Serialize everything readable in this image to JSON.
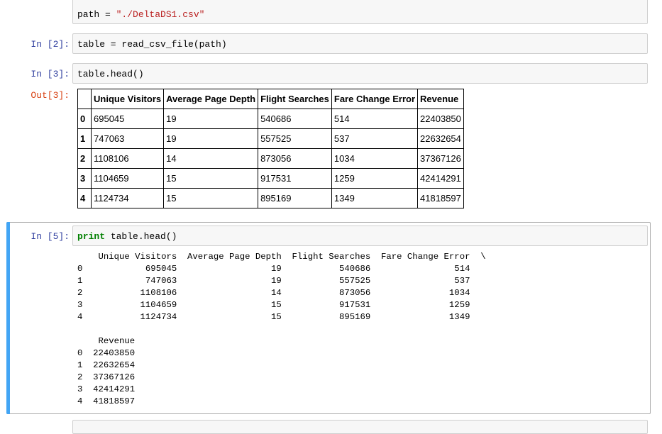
{
  "cells": [
    {
      "prompt": "",
      "code_prefix": "path = ",
      "code_string": "\"./DeltaDS1.csv\""
    },
    {
      "prompt": "In [2]:",
      "code": "table = read_csv_file(path)"
    },
    {
      "prompt": "In [3]:",
      "code": "table.head()"
    },
    {
      "out_prompt": "Out[3]:"
    },
    {
      "prompt": "In [5]:",
      "code_keyword": "print",
      "code_rest": " table.head()"
    }
  ],
  "dataframe": {
    "columns": [
      "Unique Visitors",
      "Average Page Depth",
      "Flight Searches",
      "Fare Change Error",
      "Revenue"
    ],
    "rows": [
      {
        "index": "0",
        "values": [
          "695045",
          "19",
          "540686",
          "514",
          "22403850"
        ]
      },
      {
        "index": "1",
        "values": [
          "747063",
          "19",
          "557525",
          "537",
          "22632654"
        ]
      },
      {
        "index": "2",
        "values": [
          "1108106",
          "14",
          "873056",
          "1034",
          "37367126"
        ]
      },
      {
        "index": "3",
        "values": [
          "1104659",
          "15",
          "917531",
          "1259",
          "42414291"
        ]
      },
      {
        "index": "4",
        "values": [
          "1124734",
          "15",
          "895169",
          "1349",
          "41818597"
        ]
      }
    ]
  },
  "print_output": {
    "block1": "    Unique Visitors  Average Page Depth  Flight Searches  Fare Change Error  \\\n0            695045                  19           540686                514   \n1            747063                  19           557525                537   \n2           1108106                  14           873056               1034   \n3           1104659                  15           917531               1259   \n4           1124734                  15           895169               1349   ",
    "block2": "    Revenue  \n0  22403850  \n1  22632654  \n2  37367126  \n3  42414291  \n4  41818597  "
  },
  "colors": {
    "in_prompt": "#303f9f",
    "out_prompt": "#d84315",
    "string": "#ba2121",
    "keyword": "#008000",
    "selected_bar": "#42a5f5"
  }
}
